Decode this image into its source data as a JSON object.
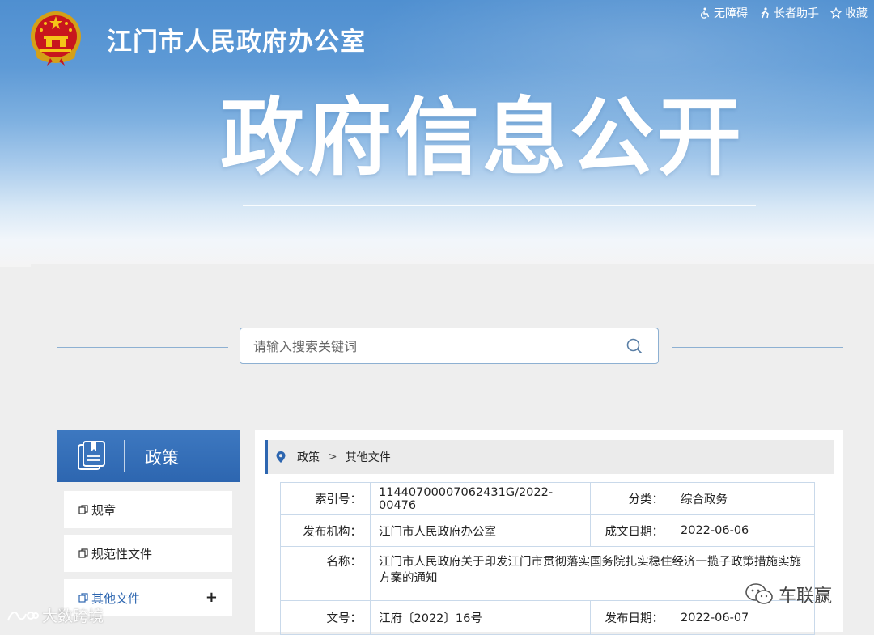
{
  "header": {
    "site_title": "江门市人民政府办公室",
    "big_title": "政府信息公开",
    "links": [
      {
        "label": "无障碍",
        "icon": "wheelchair-icon"
      },
      {
        "label": "长者助手",
        "icon": "elder-icon"
      },
      {
        "label": "收藏",
        "icon": "star-icon"
      }
    ]
  },
  "search": {
    "placeholder": "请输入搜索关键词"
  },
  "sidebar": {
    "title": "政策",
    "items": [
      {
        "label": "规章"
      },
      {
        "label": "规范性文件"
      },
      {
        "label": "其他文件",
        "expander": "+"
      }
    ]
  },
  "breadcrumb": {
    "items": [
      "政策",
      "其他文件"
    ],
    "separator": ">"
  },
  "meta": {
    "index_label": "索引号：",
    "index_value": "11440700007062431G/2022-00476",
    "category_label": "分类：",
    "category_value": "综合政务",
    "publisher_label": "发布机构：",
    "publisher_value": "江门市人民政府办公室",
    "created_label": "成文日期：",
    "created_value": "2022-06-06",
    "name_label": "名称：",
    "name_value": "江门市人民政府关于印发江门市贯彻落实国务院扎实稳住经济一揽子政策措施实施方案的通知",
    "docno_label": "文号：",
    "docno_value": "江府〔2022〕16号",
    "published_label": "发布日期：",
    "published_value": "2022-06-07"
  },
  "watermarks": {
    "left": "大数跨境",
    "right": "车联赢"
  },
  "colors": {
    "accent": "#2d66b0",
    "header_top": "#4f8fd0",
    "border": "#c9d9ea"
  }
}
